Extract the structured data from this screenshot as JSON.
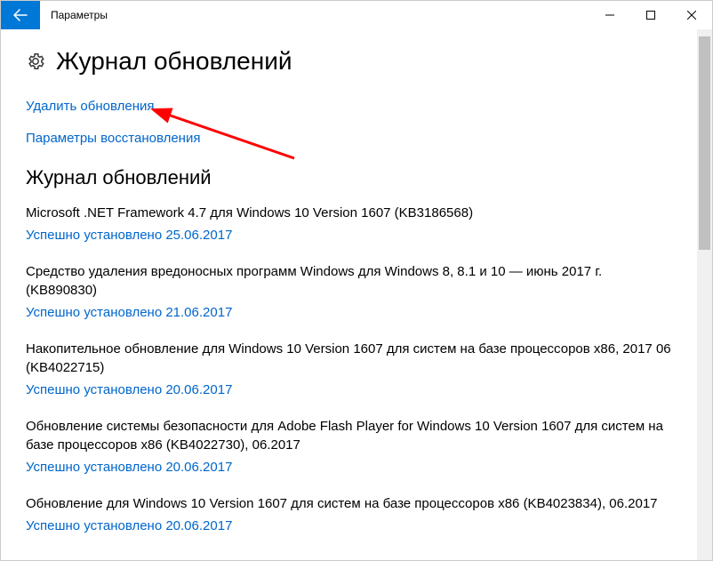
{
  "window": {
    "title": "Параметры"
  },
  "header": {
    "title": "Журнал обновлений"
  },
  "links": {
    "uninstall": "Удалить обновления",
    "recovery": "Параметры восстановления"
  },
  "section_title": "Журнал обновлений",
  "updates": [
    {
      "name": "Microsoft .NET Framework 4.7 для Windows 10 Version 1607 (KB3186568)",
      "status": "Успешно установлено 25.06.2017"
    },
    {
      "name": "Средство удаления вредоносных программ Windows для Windows 8, 8.1 и 10 — июнь 2017 г. (KB890830)",
      "status": "Успешно установлено 21.06.2017"
    },
    {
      "name": "Накопительное обновление для Windows 10 Version 1607 для систем на базе процессоров x86, 2017 06 (KB4022715)",
      "status": "Успешно установлено 20.06.2017"
    },
    {
      "name": "Обновление системы безопасности для Adobe Flash Player for Windows 10 Version 1607 для систем на базе процессоров x86 (KB4022730), 06.2017",
      "status": "Успешно установлено 20.06.2017"
    },
    {
      "name": "Обновление для Windows 10 Version 1607 для систем на базе процессоров x86 (KB4023834), 06.2017",
      "status": "Успешно установлено 20.06.2017"
    }
  ]
}
